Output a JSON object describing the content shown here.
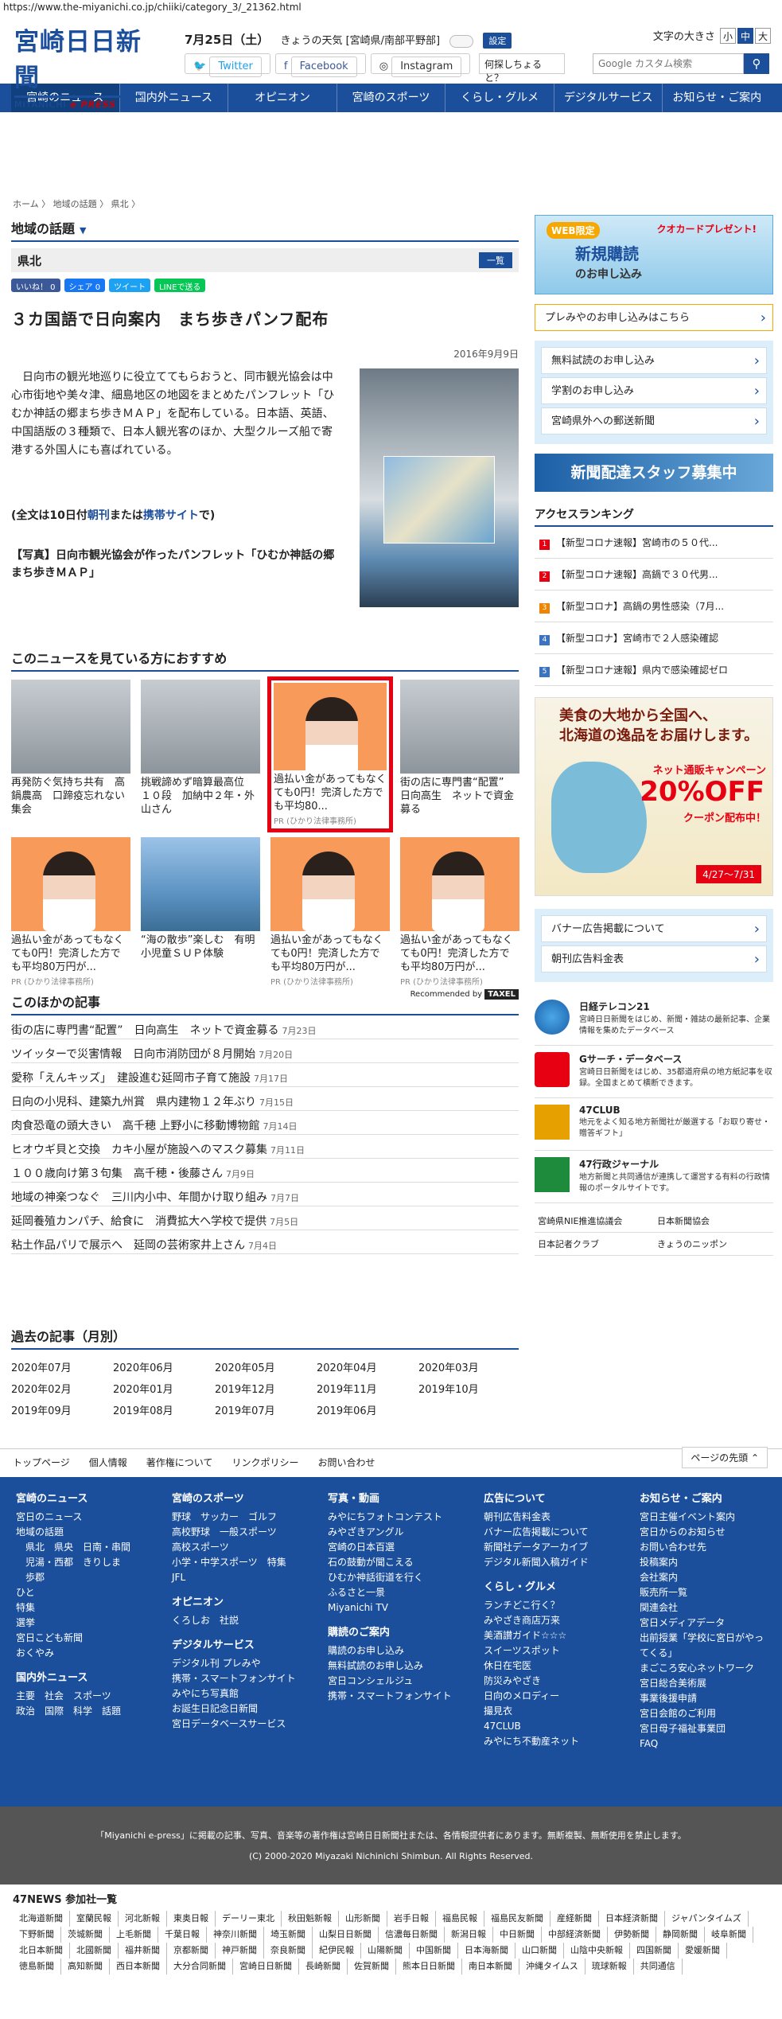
{
  "url": "https://www.the-miyanichi.co.jp/chiiki/category_3/_21362.html",
  "header": {
    "logo_main": "宮崎日日新聞",
    "logo_sub": "MIYANICHI",
    "logo_sub2": "e PRESS",
    "date": "7月25日（土）",
    "weather": "きょうの天気 [宮崎県/南部平野部]",
    "settings": "設定",
    "twitter": "Twitter",
    "facebook": "Facebook",
    "instagram": "Instagram",
    "font_size_label": "文字の大きさ",
    "font_sizes": [
      "小",
      "中",
      "大"
    ],
    "query": "何探しちょると？",
    "search_placeholder": "Google カスタム検索"
  },
  "nav": [
    "宮崎のニュース",
    "国内外ニュース",
    "オピニオン",
    "宮崎のスポーツ",
    "くらし・グルメ",
    "デジタルサービス",
    "お知らせ・ご案内"
  ],
  "breadcrumb": "ホーム 〉 地域の話題 〉 県北 〉",
  "article": {
    "section": "地域の話題",
    "region": "県北",
    "list_btn": "一覧",
    "share": [
      "いいね！ 0",
      "シェア 0",
      "ツイート",
      "LINEで送る"
    ],
    "title": "３カ国語で日向案内　まち歩きパンフ配布",
    "date": "2016年9月9日",
    "body": "日向市の観光地巡りに役立ててもらおうと、同市観光協会は中心市街地や美々津、細島地区の地図をまとめたパンフレット「ひむか神話の郷まち歩きＭＡＰ」を配布している。日本語、英語、中国語版の３種類で、日本人観光客のほか、大型クルーズ船で寄港する外国人にも喜ばれている。",
    "fulltext_a": "(全文は10日付",
    "fulltext_b": "朝刊",
    "fulltext_c": "または",
    "fulltext_d": "携帯サイト",
    "fulltext_e": "で)",
    "caption": "【写真】日向市観光協会が作ったパンフレット「ひむか神話の郷まち歩きＭＡＰ」"
  },
  "recommend": {
    "heading": "このニュースを見ている方におすすめ",
    "items": [
      {
        "text": "再発防ぐ気持ち共有　高鍋農高　口蹄疫忘れない集会",
        "pr": ""
      },
      {
        "text": "挑戦諦めず暗算最高位　１０段　加納中２年・外山さん",
        "pr": ""
      },
      {
        "text": "過払い金があってもなくても0円！完済した方でも平均80...",
        "pr": "PR (ひかり法律事務所)"
      },
      {
        "text": "街の店に専門書“配置”　日向高生　ネットで資金募る",
        "pr": ""
      },
      {
        "text": "過払い金があってもなくても0円！完済した方でも平均80万円が...",
        "pr": "PR (ひかり法律事務所)"
      },
      {
        "text": "“海の散歩”楽しむ　有明小児童ＳＵＰ体験",
        "pr": ""
      },
      {
        "text": "過払い金があってもなくても0円！完済した方でも平均80万円が...",
        "pr": "PR (ひかり法律事務所)"
      },
      {
        "text": "過払い金があってもなくても0円！完済した方でも平均80万円が...",
        "pr": "PR (ひかり法律事務所)"
      }
    ],
    "recommended_by": "Recommended by",
    "recommended_brand": "TAXEL"
  },
  "other": {
    "heading": "このほかの記事",
    "items": [
      {
        "title": "街の店に専門書“配置”　日向高生　ネットで資金募る",
        "date": "7月23日"
      },
      {
        "title": "ツイッターで災害情報　日向市消防団が８月開始",
        "date": "7月20日"
      },
      {
        "title": "愛称「えんキッズ」　建設進む延岡市子育て施設",
        "date": "7月17日"
      },
      {
        "title": "日向の小児科、建築九州賞　県内建物１２年ぶり",
        "date": "7月15日"
      },
      {
        "title": "肉食恐竜の頭大きい　高千穂 上野小に移動博物館",
        "date": "7月14日"
      },
      {
        "title": "ヒオウギ貝と交換　カキ小屋が施設へのマスク募集",
        "date": "7月11日"
      },
      {
        "title": "１００歳向け第３句集　高千穂・後藤さん",
        "date": "7月9日"
      },
      {
        "title": "地域の神楽つなぐ　三川内小中、年間かけ取り組み",
        "date": "7月7日"
      },
      {
        "title": "延岡養殖カンパチ、給食に　消費拡大へ学校で提供",
        "date": "7月5日"
      },
      {
        "title": "粘土作品パリで展示へ　延岡の芸術家井上さん",
        "date": "7月4日"
      }
    ]
  },
  "past": {
    "heading": "過去の記事（月別）",
    "months": [
      "2020年07月",
      "2020年06月",
      "2020年05月",
      "2020年04月",
      "2020年03月",
      "2020年02月",
      "2020年01月",
      "2019年12月",
      "2019年11月",
      "2019年10月",
      "2019年09月",
      "2019年08月",
      "2019年07月",
      "2019年06月"
    ]
  },
  "side": {
    "banner_tag": "WEB限定",
    "banner_title": "新規購読",
    "banner_sub": "のお申し込み",
    "banner_present": "クオカードプレゼント!",
    "premium": "プレみやのお申し込みはこちら",
    "trial": "無料試読のお申し込み",
    "student": "学割のお申し込み",
    "outside": "宮崎県外への郵送新聞",
    "recruit": "新聞配達スタッフ募集中",
    "ranking_heading": "アクセスランキング",
    "ranking": [
      "【新型コロナ速報】宮崎市の５０代...",
      "【新型コロナ速報】高鍋で３０代男...",
      "【新型コロナ】高鍋の男性感染（7月...",
      "【新型コロナ】宮崎市で２人感染確認",
      "【新型コロナ速報】県内で感染確認ゼロ"
    ],
    "ad_line1": "美食の大地から全国へ、",
    "ad_line2": "北海道の逸品をお届けします。",
    "ad_campaign": "ネット通販キャンペーン",
    "ad_off": "20%OFF",
    "ad_coupon": "クーポン配布中！",
    "ad_period": "4/27～7/31",
    "banner_ad": "バナー広告掲載について",
    "paper_ad": "朝刊広告料金表",
    "services": [
      {
        "name": "日経テレコン21",
        "desc": "宮崎日日新聞をはじめ、新聞・雑誌の最新記事、企業情報を集めたデータベース"
      },
      {
        "name": "Gサーチ・データベース",
        "desc": "宮崎日日新聞をはじめ、35都道府県の地方紙記事を収録。全国まとめて横断できます。"
      },
      {
        "name": "47CLUB",
        "desc": "地元をよく知る地方新聞社が厳選する「お取り寄せ・贈答ギフト」"
      },
      {
        "name": "47行政ジャーナル",
        "desc": "地方新聞と共同通信が連携して運営する有料の行政情報のポータルサイトです。"
      }
    ],
    "links": [
      "宮崎県NIE推進協議会",
      "日本新聞協会",
      "日本記者クラブ",
      "きょうのニッポン"
    ]
  },
  "footlinks": [
    "トップページ",
    "個人情報",
    "著作権について",
    "リンクポリシー",
    "お問い合わせ"
  ],
  "pagetop": "ページの先頭",
  "footer": {
    "c1_h": "宮崎のニュース",
    "c1": [
      "宮日のニュース",
      "地域の話題",
      "　県北　県央　日南・串間",
      "　児湯・西都　きりしま",
      "　歩郡",
      "ひと",
      "特集",
      "選挙",
      "宮日こども新聞",
      "おくやみ"
    ],
    "c1b_h": "国内外ニュース",
    "c1b": [
      "主要　社会　スポーツ",
      "政治　国際　科学　話題"
    ],
    "c2_h": "宮崎のスポーツ",
    "c2": [
      "野球　サッカー　ゴルフ",
      "高校野球　一般スポーツ",
      "高校スポーツ",
      "小学・中学スポーツ　特集",
      "JFL"
    ],
    "c2b_h": "オピニオン",
    "c2b": [
      "くろしお　社説"
    ],
    "c2c_h": "デジタルサービス",
    "c2c": [
      "デジタル刊 プレみや",
      "携帯・スマートフォンサイト",
      "みやにち写真館",
      "お誕生日記念日新聞",
      "宮日データベースサービス"
    ],
    "c3_h": "写真・動画",
    "c3": [
      "みやにちフォトコンテスト",
      "みやざきアングル",
      "宮崎の日本百選",
      "石の鼓動が聞こえる",
      "ひむか神話街道を行く",
      "ふるさと一景",
      "Miyanichi TV"
    ],
    "c3b_h": "購読のご案内",
    "c3b": [
      "購読のお申し込み",
      "無料試読のお申し込み",
      "宮日コンシェルジュ",
      "携帯・スマートフォンサイト"
    ],
    "c4_h": "広告について",
    "c4": [
      "朝刊広告料金表",
      "バナー広告掲載について",
      "新聞社データアーカイブ",
      "デジタル新聞入稿ガイド"
    ],
    "c4b_h": "くらし・グルメ",
    "c4b": [
      "ランチどこ行く？",
      "みやざき商店万来",
      "美酒讃ガイド☆☆☆",
      "スイーツスポット",
      "休日在宅医",
      "防災みやざき",
      "日向のメロディー",
      "撮見衣",
      "47CLUB",
      "みやにち不動産ネット"
    ],
    "c5_h": "お知らせ・ご案内",
    "c5": [
      "宮日主催イベント案内",
      "宮日からのお知らせ",
      "お問い合わせ先",
      "投稿案内",
      "会社案内",
      "販売所一覧",
      "関連会社",
      "宮日メディアデータ",
      "出前授業「学校に宮日がやってくる」",
      "まごころ安心ネットワーク",
      "宮日総合美術展",
      "事業後援申請",
      "宮日会館のご利用",
      "宮日母子福祉事業団",
      "FAQ"
    ]
  },
  "copyright1": "「Miyanichi e-press」に掲載の記事、写真、音楽等の著作権は宮崎日日新聞社または、各情報提供者にあります。無断複製、無断使用を禁止します。",
  "copyright2": "(C) 2000-2020 Miyazaki Nichinichi Shimbun. All Rights Reserved.",
  "news47": {
    "heading": "47NEWS 参加社一覧",
    "list": [
      "北海道新聞",
      "室蘭民報",
      "河北新報",
      "東奥日報",
      "デーリー東北",
      "秋田魁新報",
      "山形新聞",
      "岩手日報",
      "福島民報",
      "福島民友新聞",
      "産経新聞",
      "日本経済新聞",
      "ジャパンタイムズ",
      "下野新聞",
      "茨城新聞",
      "上毛新聞",
      "千葉日報",
      "神奈川新聞",
      "埼玉新聞",
      "山梨日日新聞",
      "信濃毎日新聞",
      "新潟日報",
      "中日新聞",
      "中部経済新聞",
      "伊勢新聞",
      "静岡新聞",
      "岐阜新聞",
      "北日本新聞",
      "北國新聞",
      "福井新聞",
      "京都新聞",
      "神戸新聞",
      "奈良新聞",
      "紀伊民報",
      "山陽新聞",
      "中国新聞",
      "日本海新聞",
      "山口新聞",
      "山陰中央新報",
      "四国新聞",
      "愛媛新聞",
      "徳島新聞",
      "高知新聞",
      "西日本新聞",
      "大分合同新聞",
      "宮崎日日新聞",
      "長崎新聞",
      "佐賀新聞",
      "熊本日日新聞",
      "南日本新聞",
      "沖縄タイムス",
      "琉球新報",
      "共同通信"
    ]
  }
}
